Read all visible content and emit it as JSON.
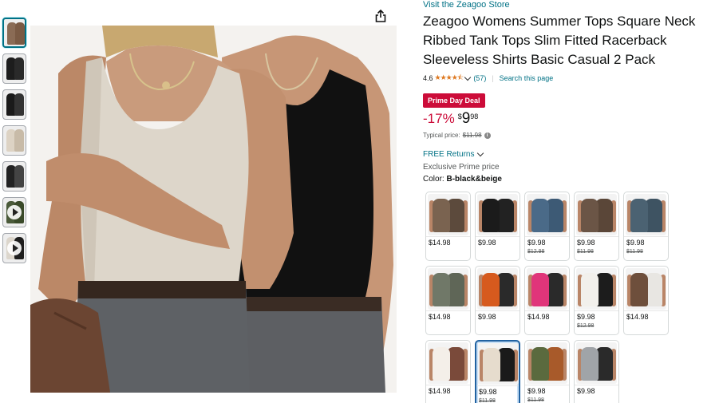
{
  "store_link": "Visit the Zeagoo Store",
  "title": "Zeagoo Womens Summer Tops Square Neck Ribbed Tank Tops Slim Fitted Racerback Sleeveless Shirts Basic Casual 2 Pack",
  "rating": {
    "value": "4.6",
    "stars": "★★★★⯪",
    "reviews": "(57)",
    "search_link": "Search this page"
  },
  "deal_badge": "Prime Day Deal",
  "price": {
    "discount": "-17%",
    "symbol": "$",
    "whole": "9",
    "fraction": "98",
    "typical_label": "Typical price:",
    "typical_value": "$11.98"
  },
  "free_returns": "FREE Returns",
  "prime_price": "Exclusive Prime price",
  "color": {
    "label": "Color:",
    "value": "B-black&beige"
  },
  "thumbnails": [
    {
      "kind": "image",
      "c1": "#8a6b55",
      "c2": "#7a5a44"
    },
    {
      "kind": "image",
      "c1": "#1d1d1d",
      "c2": "#2a2a2a"
    },
    {
      "kind": "image",
      "c1": "#1a1a1a",
      "c2": "#333333"
    },
    {
      "kind": "image",
      "c1": "#ddd3c4",
      "c2": "#c8bba8"
    },
    {
      "kind": "image",
      "c1": "#222222",
      "c2": "#444444"
    },
    {
      "kind": "video",
      "c1": "#4a5a3a",
      "c2": "#3a4a2a"
    },
    {
      "kind": "video",
      "c1": "#dcd6cc",
      "c2": "#1e1e1e"
    }
  ],
  "swatches": [
    {
      "price": "$14.98",
      "old": "",
      "c1": "#7a6350",
      "c2": "#5c4a3c"
    },
    {
      "price": "$9.98",
      "old": "",
      "c1": "#1b1b1b",
      "c2": "#222222"
    },
    {
      "price": "$9.98",
      "old": "$12.98",
      "c1": "#4a6a88",
      "c2": "#3d5a75"
    },
    {
      "price": "$9.98",
      "old": "$11.98",
      "c1": "#6b5546",
      "c2": "#5a4638"
    },
    {
      "price": "$9.98",
      "old": "$11.98",
      "c1": "#4b6272",
      "c2": "#3e5362"
    },
    {
      "price": "$14.98",
      "old": "",
      "c1": "#707868",
      "c2": "#5f6657"
    },
    {
      "price": "$9.98",
      "old": "",
      "c1": "#d65a1e",
      "c2": "#2a2a2a"
    },
    {
      "price": "$14.98",
      "old": "",
      "c1": "#e0357a",
      "c2": "#2a2a2a"
    },
    {
      "price": "$9.98",
      "old": "$12.98",
      "c1": "#f2f0ec",
      "c2": "#1c1c1c"
    },
    {
      "price": "$14.98",
      "old": "",
      "c1": "#6e4f3c",
      "c2": "#e8e6e2"
    },
    {
      "price": "$14.98",
      "old": "",
      "c1": "#f4efe9",
      "c2": "#7a4a3a"
    },
    {
      "price": "$9.98",
      "old": "$11.98",
      "c1": "#e6dccd",
      "c2": "#1a1a1a"
    },
    {
      "price": "$9.98",
      "old": "$11.98",
      "c1": "#5a6a3e",
      "c2": "#a85a2a"
    },
    {
      "price": "$9.98",
      "old": "",
      "c1": "#a0a4a8",
      "c2": "#2a2a2a"
    }
  ],
  "colors": {
    "link": "#007185",
    "deal": "#cc0c39",
    "star": "#de7921",
    "selected_border": "#2162a1"
  }
}
